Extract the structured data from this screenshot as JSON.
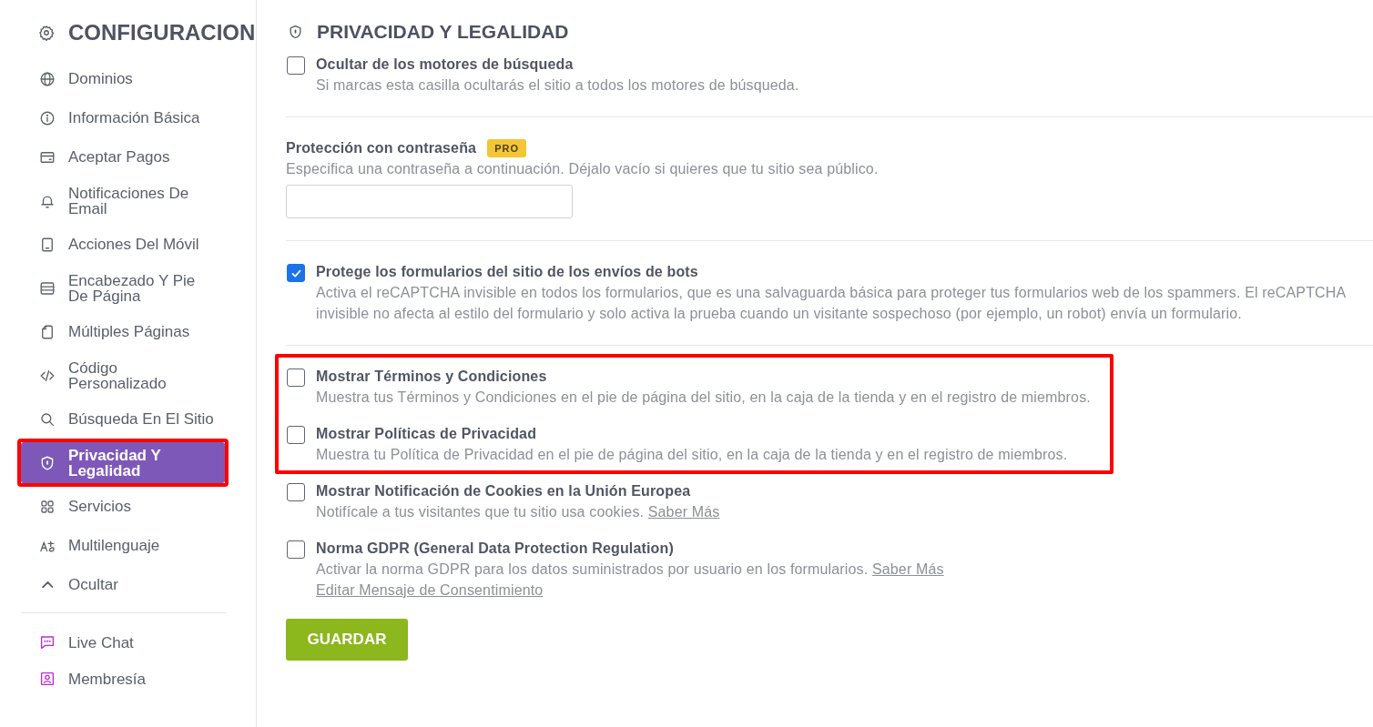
{
  "sidebar": {
    "title": "CONFIGURACION",
    "items": [
      {
        "label": "Dominios",
        "selected": false,
        "highlighted": false
      },
      {
        "label": "Información Básica",
        "selected": false,
        "highlighted": false
      },
      {
        "label": "Aceptar Pagos",
        "selected": false,
        "highlighted": false
      },
      {
        "label": "Notificaciones De Email",
        "selected": false,
        "highlighted": false
      },
      {
        "label": "Acciones Del Móvil",
        "selected": false,
        "highlighted": false
      },
      {
        "label": "Encabezado Y Pie De Página",
        "selected": false,
        "highlighted": false
      },
      {
        "label": "Múltiples Páginas",
        "selected": false,
        "highlighted": false
      },
      {
        "label": "Código Personalizado",
        "selected": false,
        "highlighted": false
      },
      {
        "label": "Búsqueda En El Sitio",
        "selected": false,
        "highlighted": false
      },
      {
        "label": "Privacidad Y Legalidad",
        "selected": true,
        "highlighted": true
      },
      {
        "label": "Servicios",
        "selected": false,
        "highlighted": false
      },
      {
        "label": "Multilenguaje",
        "selected": false,
        "highlighted": false
      }
    ],
    "collapse_toggle": {
      "label": "Ocultar",
      "expanded": true
    },
    "apps": [
      {
        "label": "Live Chat"
      },
      {
        "label": "Membresía"
      }
    ]
  },
  "page": {
    "title": "PRIVACIDAD Y LEGALIDAD",
    "groups": [
      {
        "settings": [
          {
            "kind": "checkbox",
            "title": "Ocultar de los motores de búsqueda",
            "description": "Si marcas esta casilla ocultarás el sitio a todos los motores de búsqueda.",
            "checked": false,
            "highlighted": false
          }
        ]
      },
      {
        "settings": [
          {
            "kind": "password",
            "title": "Protección con contraseña",
            "badge": "PRO",
            "description": "Especifica una contraseña a continuación. Déjalo vacío si quieres que tu sitio sea público.",
            "highlighted": false
          }
        ]
      },
      {
        "settings": [
          {
            "kind": "checkbox",
            "title": "Protege los formularios del sitio de los envíos de bots",
            "description": "Activa el reCAPTCHA invisible en todos los formularios, que es una salvaguarda básica para proteger tus formularios web de los spammers. El reCAPTCHA invisible no afecta al estilo del formulario y solo activa la prueba cuando un visitante sospechoso (por ejemplo, un robot) envía un formulario.",
            "checked": true,
            "highlighted": false
          }
        ]
      },
      {
        "settings": [
          {
            "kind": "checkbox",
            "title": "Mostrar Términos y Condiciones",
            "description": "Muestra tus Términos y Condiciones en el pie de página del sitio, en la caja de la tienda y en el registro de miembros.",
            "checked": false,
            "highlighted": true
          },
          {
            "kind": "checkbox",
            "title": "Mostrar Políticas de Privacidad",
            "description": "Muestra tu Política de Privacidad en el pie de página del sitio, en la caja de la tienda y en el registro de miembros.",
            "checked": false,
            "highlighted": true
          },
          {
            "kind": "checkbox",
            "title": "Mostrar Notificación de Cookies en la Unión Europea",
            "description": "Notifícale a tus visitantes que tu sitio usa cookies.",
            "links": [
              {
                "label": "Saber Más",
                "kind": "inline"
              }
            ],
            "checked": false,
            "highlighted": false
          },
          {
            "kind": "checkbox",
            "title": "Norma GDPR (General Data Protection Regulation)",
            "description": "Activar la norma GDPR para los datos suministrados por usuario en los formularios.",
            "links": [
              {
                "label": "Saber Más",
                "kind": "inline"
              },
              {
                "label": "Editar Mensaje de Consentimiento",
                "kind": "block"
              }
            ],
            "checked": false,
            "highlighted": false
          }
        ]
      }
    ],
    "save_button": {
      "label": "GUARDAR"
    }
  }
}
